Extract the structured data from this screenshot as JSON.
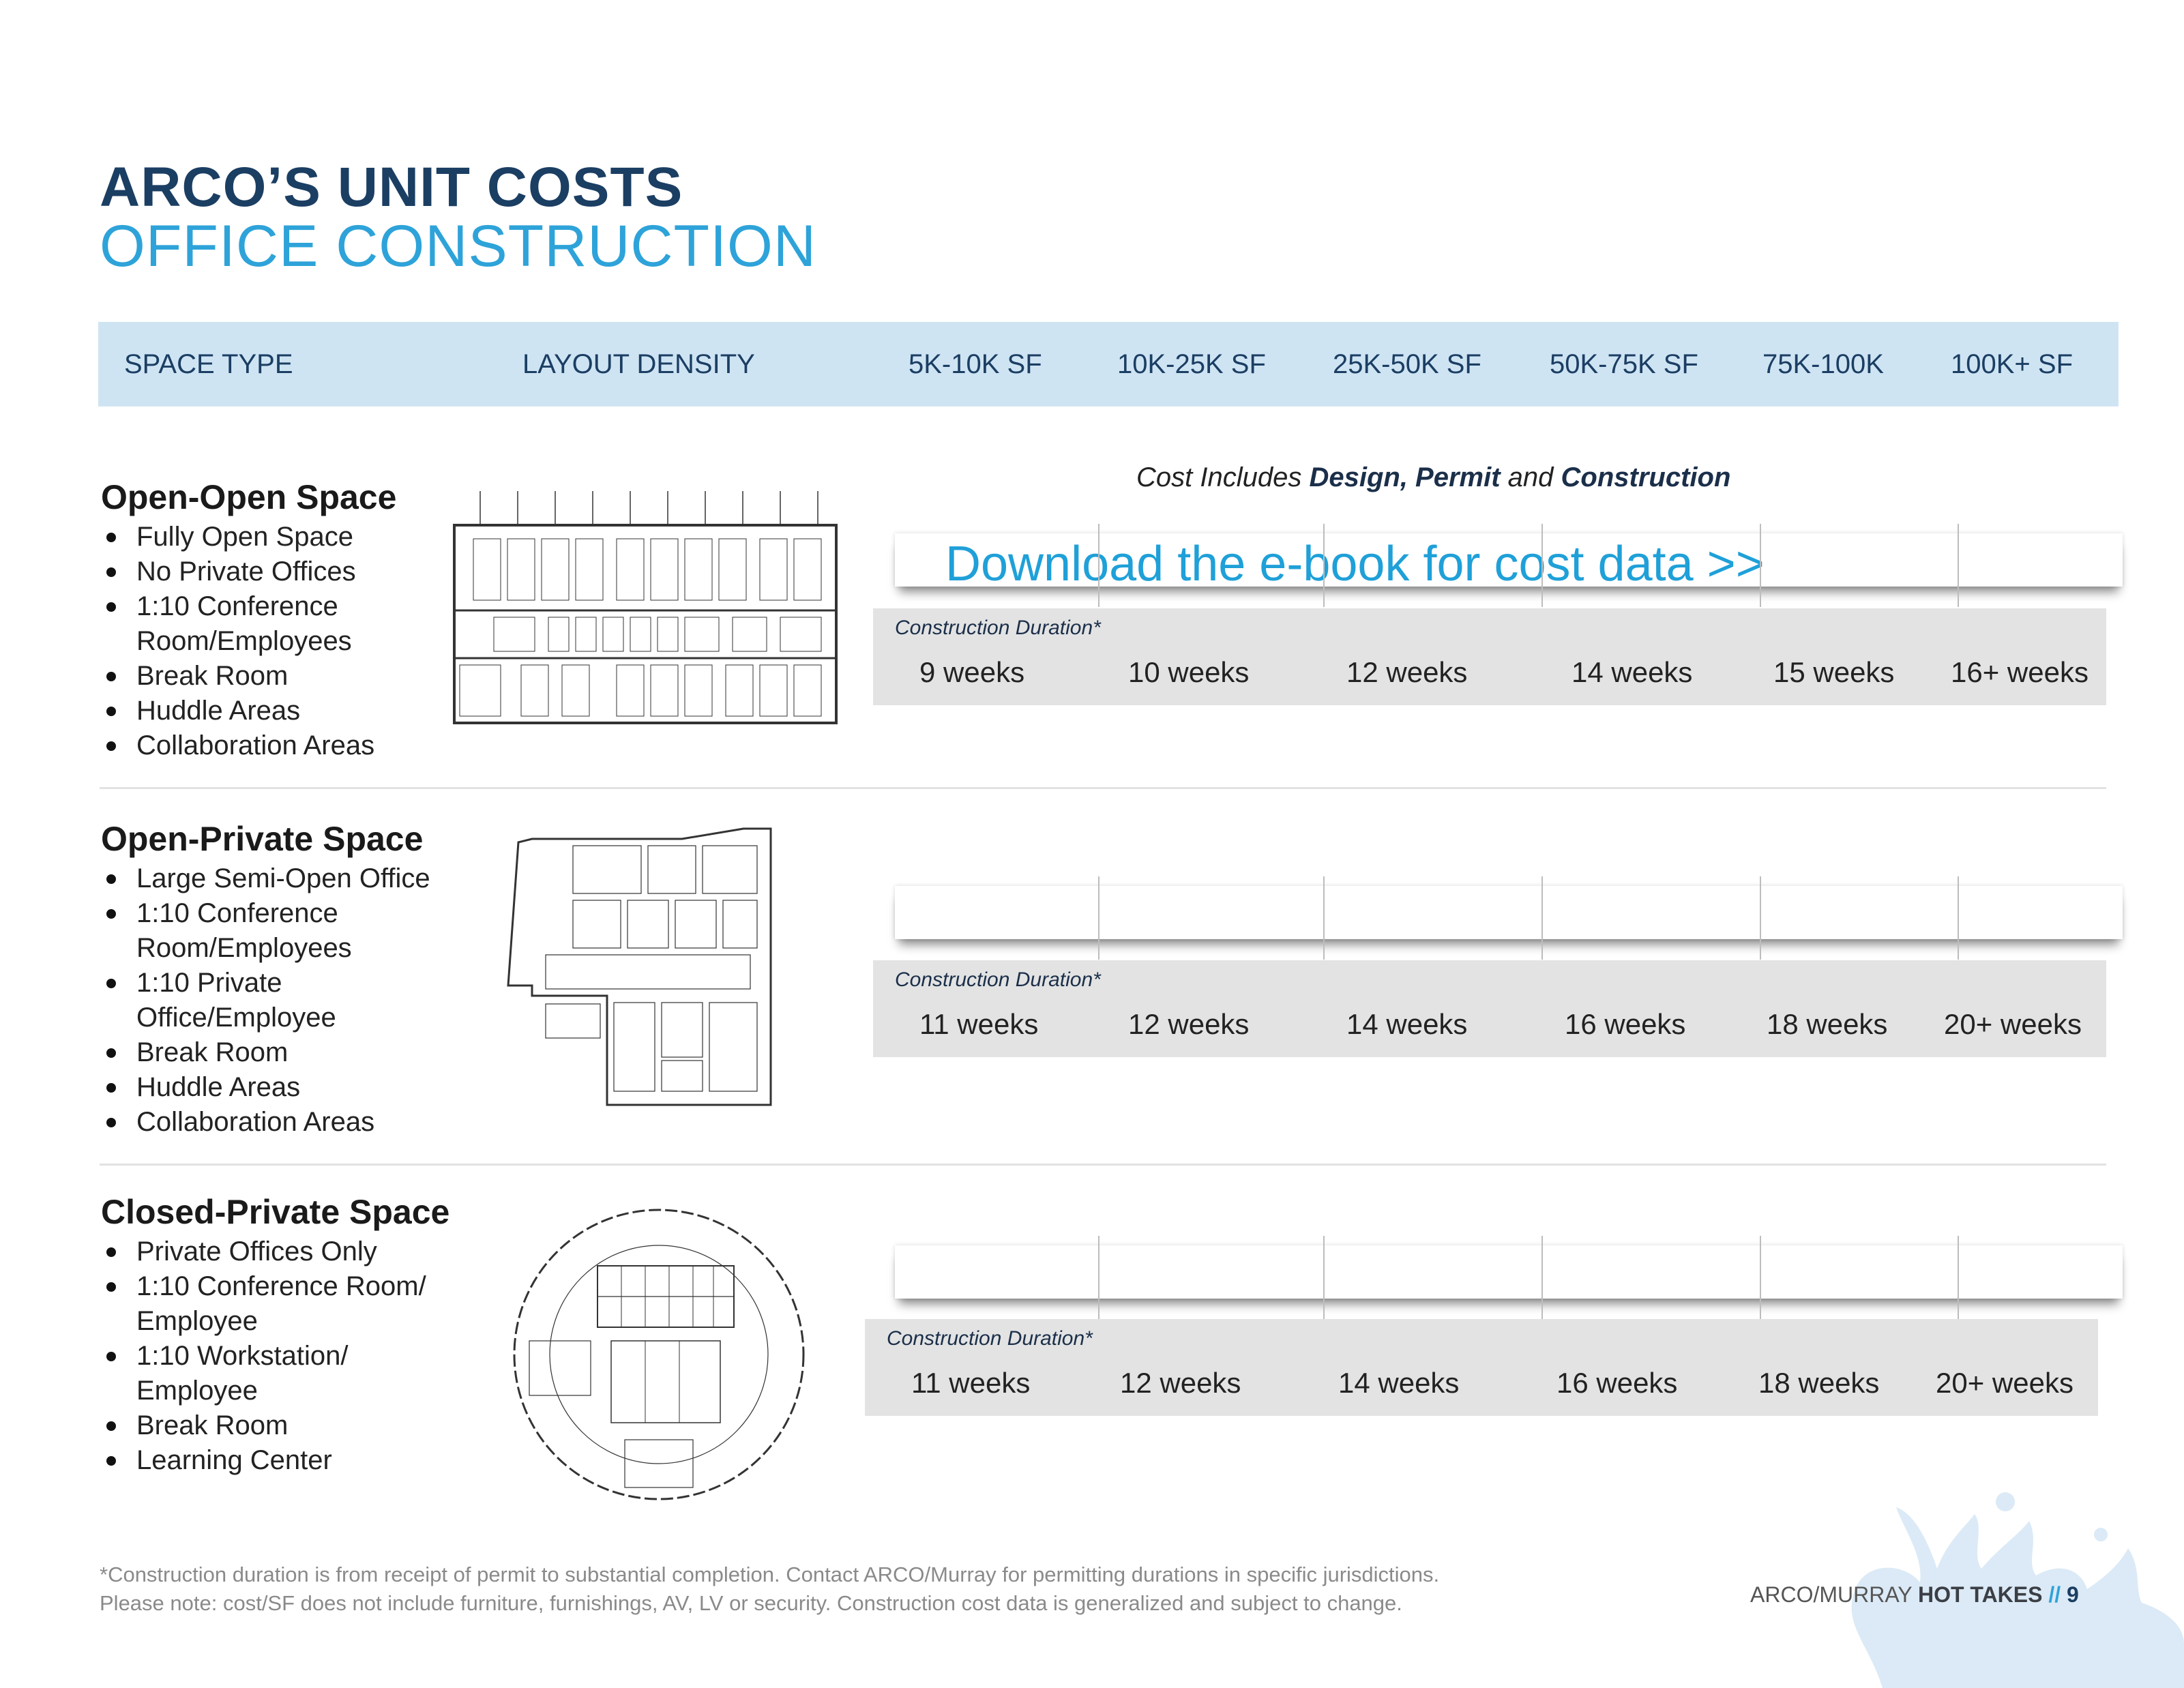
{
  "title": {
    "line1": "ARCO’S UNIT COSTS",
    "line2": "OFFICE CONSTRUCTION"
  },
  "header": {
    "columns": [
      "SPACE TYPE",
      "LAYOUT DENSITY",
      "5K-10K SF",
      "10K-25K SF",
      "25K-50K SF",
      "50K-75K SF",
      "75K-100K",
      "100K+ SF"
    ]
  },
  "cost_note": {
    "prefix": "Cost Includes ",
    "bold1": "Design, Permit",
    "mid": " and ",
    "bold2": "Construction"
  },
  "download_link": "Download the e-book for cost data >>",
  "duration_label": "Construction Duration*",
  "sections": [
    {
      "title": "Open-Open Space",
      "bullets": [
        "Fully Open Space",
        "No Private Offices",
        "1:10 Conference Room/Employees",
        "Break Room",
        "Huddle Areas",
        "Collaboration Areas"
      ],
      "durations": [
        "9 weeks",
        "10 weeks",
        "12 weeks",
        "14 weeks",
        "15 weeks",
        "16+ weeks"
      ]
    },
    {
      "title": "Open-Private Space",
      "bullets": [
        "Large Semi-Open Office",
        "1:10 Conference Room/Employees",
        "1:10 Private Office/Employee",
        "Break Room",
        "Huddle Areas",
        "Collaboration Areas"
      ],
      "durations": [
        "11 weeks",
        "12 weeks",
        "14 weeks",
        "16 weeks",
        "18 weeks",
        "20+ weeks"
      ]
    },
    {
      "title": "Closed-Private Space",
      "bullets": [
        "Private Offices Only",
        "1:10 Conference Room/ Employee",
        "1:10 Workstation/ Employee",
        "Break Room",
        "Learning Center"
      ],
      "durations": [
        "11 weeks",
        "12 weeks",
        "14 weeks",
        "16 weeks",
        "18 weeks",
        "20+ weeks"
      ]
    }
  ],
  "footnote": {
    "line1": "*Construction duration is from receipt of permit to substantial completion. Contact ARCO/Murray for permitting durations in specific jurisdictions.",
    "line2": "Please note: cost/SF does not include furniture, furnishings, AV, LV or security. Construction cost data is generalized and subject to change."
  },
  "footer_brand": {
    "company": "ARCO/MURRAY",
    "publication": "HOT TAKES",
    "separator": "//",
    "page": "9"
  },
  "colors": {
    "navy": "#1b3e63",
    "accent_blue": "#2ea3d9",
    "header_band": "#cfe4f3",
    "duration_band": "#e3e3e3"
  }
}
